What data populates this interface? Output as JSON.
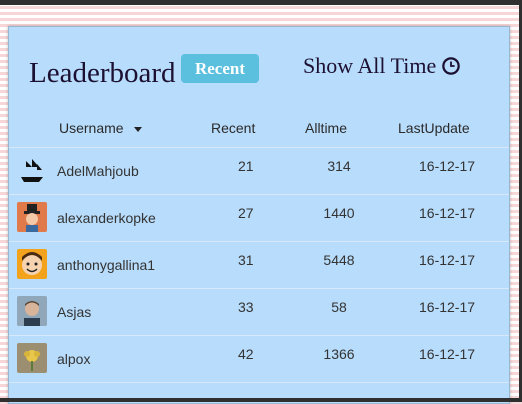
{
  "header": {
    "title": "Leaderboard",
    "recent_badge": "Recent",
    "show_all_time": "Show All Time"
  },
  "columns": {
    "username": "Username",
    "recent": "Recent",
    "alltime": "Alltime",
    "lastupdate": "LastUpdate"
  },
  "rows": [
    {
      "username": "AdelMahjoub",
      "recent": "21",
      "alltime": "314",
      "last_update": "16-12-17",
      "avatar": "ship-avatar"
    },
    {
      "username": "alexanderkopke",
      "recent": "27",
      "alltime": "1440",
      "last_update": "16-12-17",
      "avatar": "cartoon-hat-avatar"
    },
    {
      "username": "anthonygallina1",
      "recent": "31",
      "alltime": "5448",
      "last_update": "16-12-17",
      "avatar": "cartoon-face-avatar"
    },
    {
      "username": "Asjas",
      "recent": "33",
      "alltime": "58",
      "last_update": "16-12-17",
      "avatar": "photo-avatar"
    },
    {
      "username": "alpox",
      "recent": "42",
      "alltime": "1366",
      "last_update": "16-12-17",
      "avatar": "flower-avatar"
    }
  ],
  "colors": {
    "panel": "#b8dcfb",
    "badge": "#5bc0de",
    "title_text": "#1c1032"
  }
}
